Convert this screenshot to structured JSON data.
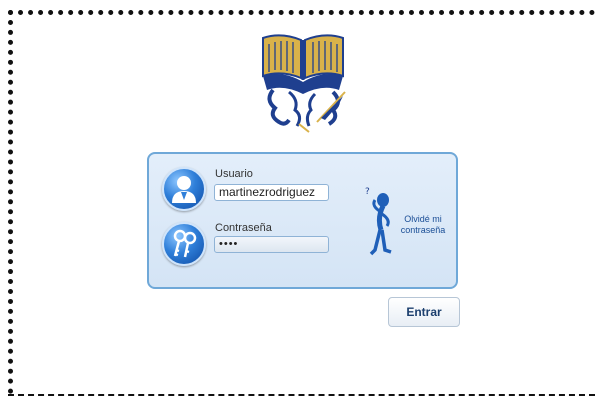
{
  "login": {
    "username_label": "Usuario",
    "username_value": "martinezrodriguez",
    "password_label": "Contraseña",
    "password_value": "••••",
    "forgot_line1": "Olvidé mi",
    "forgot_line2": "contraseña",
    "submit_label": "Entrar"
  },
  "icons": {
    "logo": "institution-logo-book-quill",
    "user": "user-icon",
    "password": "keys-icon",
    "forgot": "thinking-figure-icon"
  },
  "colors": {
    "panel_background": "#dde9f7",
    "panel_border": "#6fa8d8",
    "icon_blue": "#2f7fd9",
    "logo_gold": "#d9b24a",
    "logo_navy": "#1f3f8f"
  }
}
